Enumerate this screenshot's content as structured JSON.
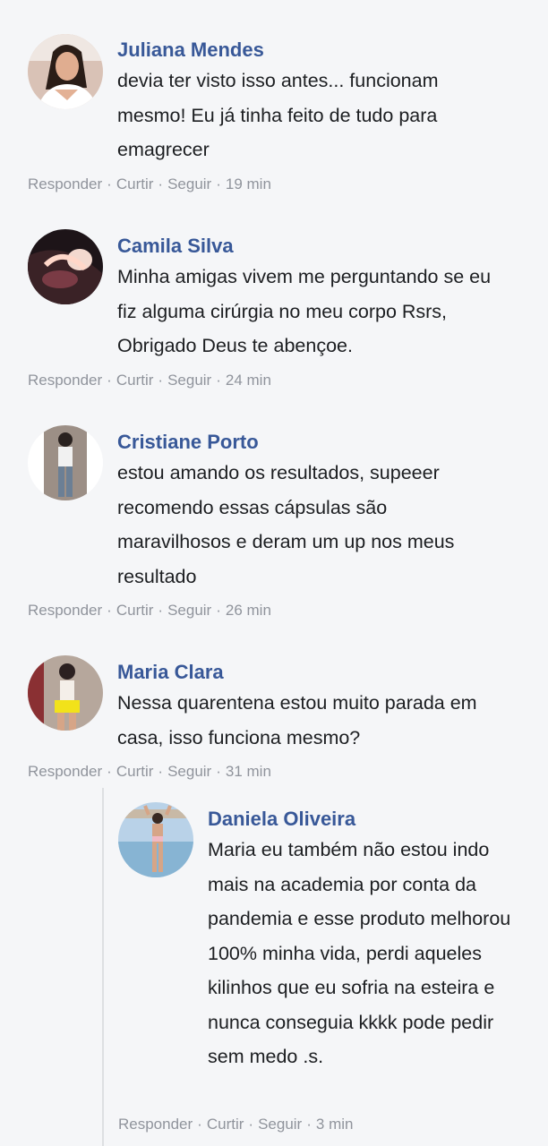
{
  "comments": [
    {
      "author": "Juliana Mendes",
      "avatar": "profile-photo-juliana",
      "text": "devia ter visto isso antes... funcionam mesmo! Eu já tinha feito de tudo para emagrecer",
      "actions": {
        "reply": "Responder",
        "like": "Curtir",
        "follow": "Seguir",
        "time": "19 min"
      }
    },
    {
      "author": "Camila Silva",
      "avatar": "profile-photo-camila",
      "text": "Minha amigas vivem me perguntando se eu fiz alguma cirúrgia no meu corpo Rsrs, Obrigado Deus te abençoe.",
      "actions": {
        "reply": "Responder",
        "like": "Curtir",
        "follow": "Seguir",
        "time": "24 min"
      }
    },
    {
      "author": "Cristiane Porto",
      "avatar": "profile-photo-cristiane",
      "text": "estou amando os resultados, supeeer recomendo essas cápsulas são maravilhosos e deram um up nos meus resultado",
      "actions": {
        "reply": "Responder",
        "like": "Curtir",
        "follow": "Seguir",
        "time": "26 min"
      }
    },
    {
      "author": "Maria Clara",
      "avatar": "profile-photo-maria",
      "text": "Nessa quarentena estou muito parada em casa, isso funciona mesmo?",
      "actions": {
        "reply": "Responder",
        "like": "Curtir",
        "follow": "Seguir",
        "time": "31 min"
      }
    }
  ],
  "reply": {
    "author": "Daniela Oliveira",
    "avatar": "profile-photo-daniela",
    "text": "Maria eu também não estou indo mais na academia por conta da pandemia e esse produto melhorou 100% minha vida, perdi aqueles kilinhos que eu sofria na esteira e nunca conseguia kkkk pode pedir sem medo .s.",
    "actions": {
      "reply": "Responder",
      "like": "Curtir",
      "follow": "Seguir",
      "time": "3 min"
    }
  },
  "colors": {
    "background": "#f5f6f8",
    "author_name": "#385898",
    "body_text": "#1c1e21",
    "meta_text": "#90949c",
    "thread_line": "#dddfe2"
  }
}
